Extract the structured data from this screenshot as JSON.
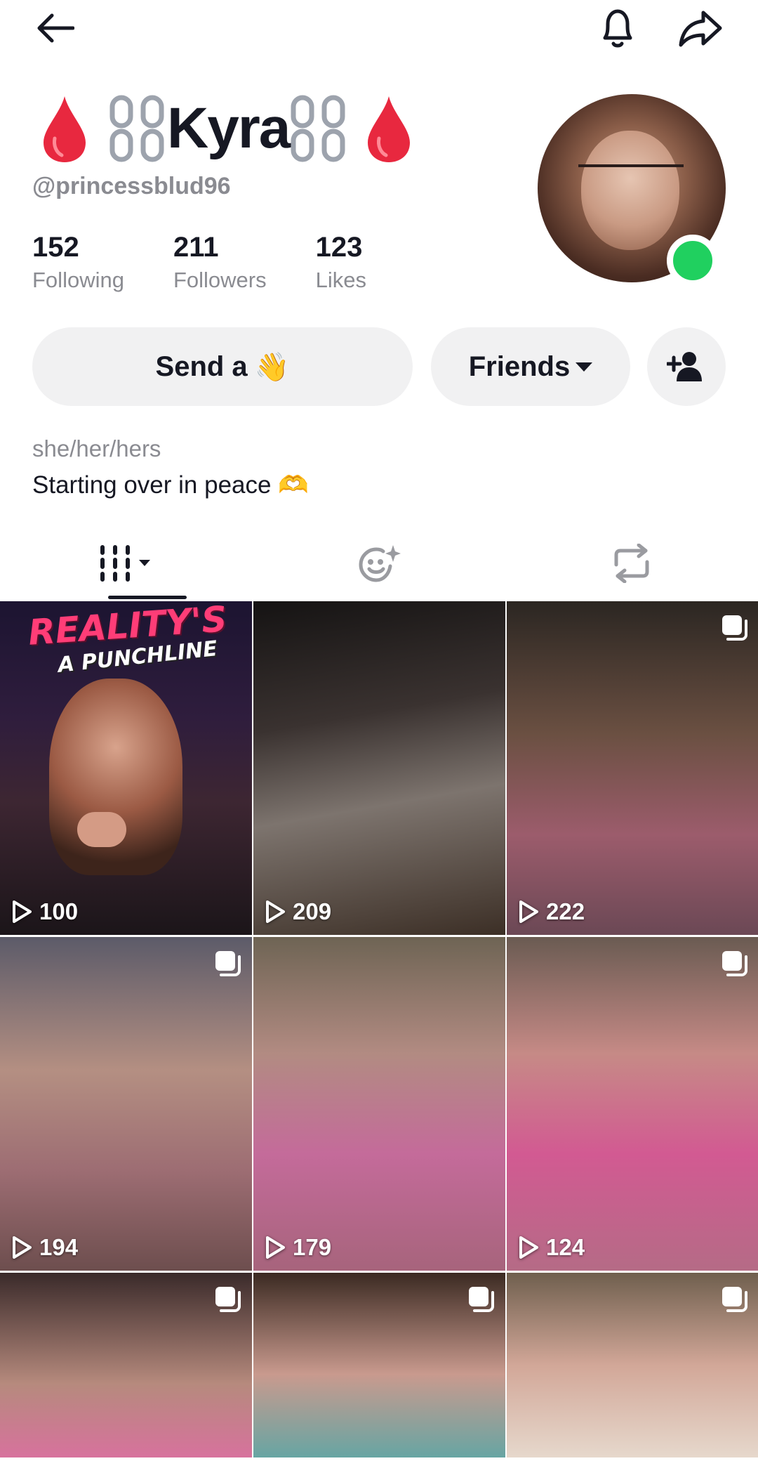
{
  "profile": {
    "display_name": "Kyra",
    "handle": "@princessblud96",
    "online": true,
    "stats": [
      {
        "value": "152",
        "label": "Following"
      },
      {
        "value": "211",
        "label": "Followers"
      },
      {
        "value": "123",
        "label": "Likes"
      }
    ],
    "pronouns": "she/her/hers",
    "bio": "Starting over in peace 🫶"
  },
  "actions": {
    "send_label": "Send a",
    "send_emoji": "👋",
    "friends_label": "Friends"
  },
  "tabs": [
    {
      "name": "videos",
      "icon": "grid-icon",
      "selected": true
    },
    {
      "name": "reposted-emoji",
      "icon": "emoji-icon",
      "selected": false
    },
    {
      "name": "reposts",
      "icon": "repost-icon",
      "selected": false
    }
  ],
  "grid": {
    "items": [
      {
        "views": "100",
        "art_title": "REALITY'S",
        "art_subtitle": "A PUNCHLINE",
        "multi": false
      },
      {
        "views": "209",
        "multi": false
      },
      {
        "views": "222",
        "multi": true
      },
      {
        "views": "194",
        "multi": true
      },
      {
        "views": "179",
        "multi": false
      },
      {
        "views": "124",
        "multi": true
      },
      {
        "views": "",
        "multi": true
      },
      {
        "views": "",
        "multi": true
      },
      {
        "views": "",
        "multi": true
      }
    ]
  },
  "colors": {
    "online": "#20d05f",
    "button_bg": "#f1f1f2",
    "muted_text": "#8a8b91"
  }
}
